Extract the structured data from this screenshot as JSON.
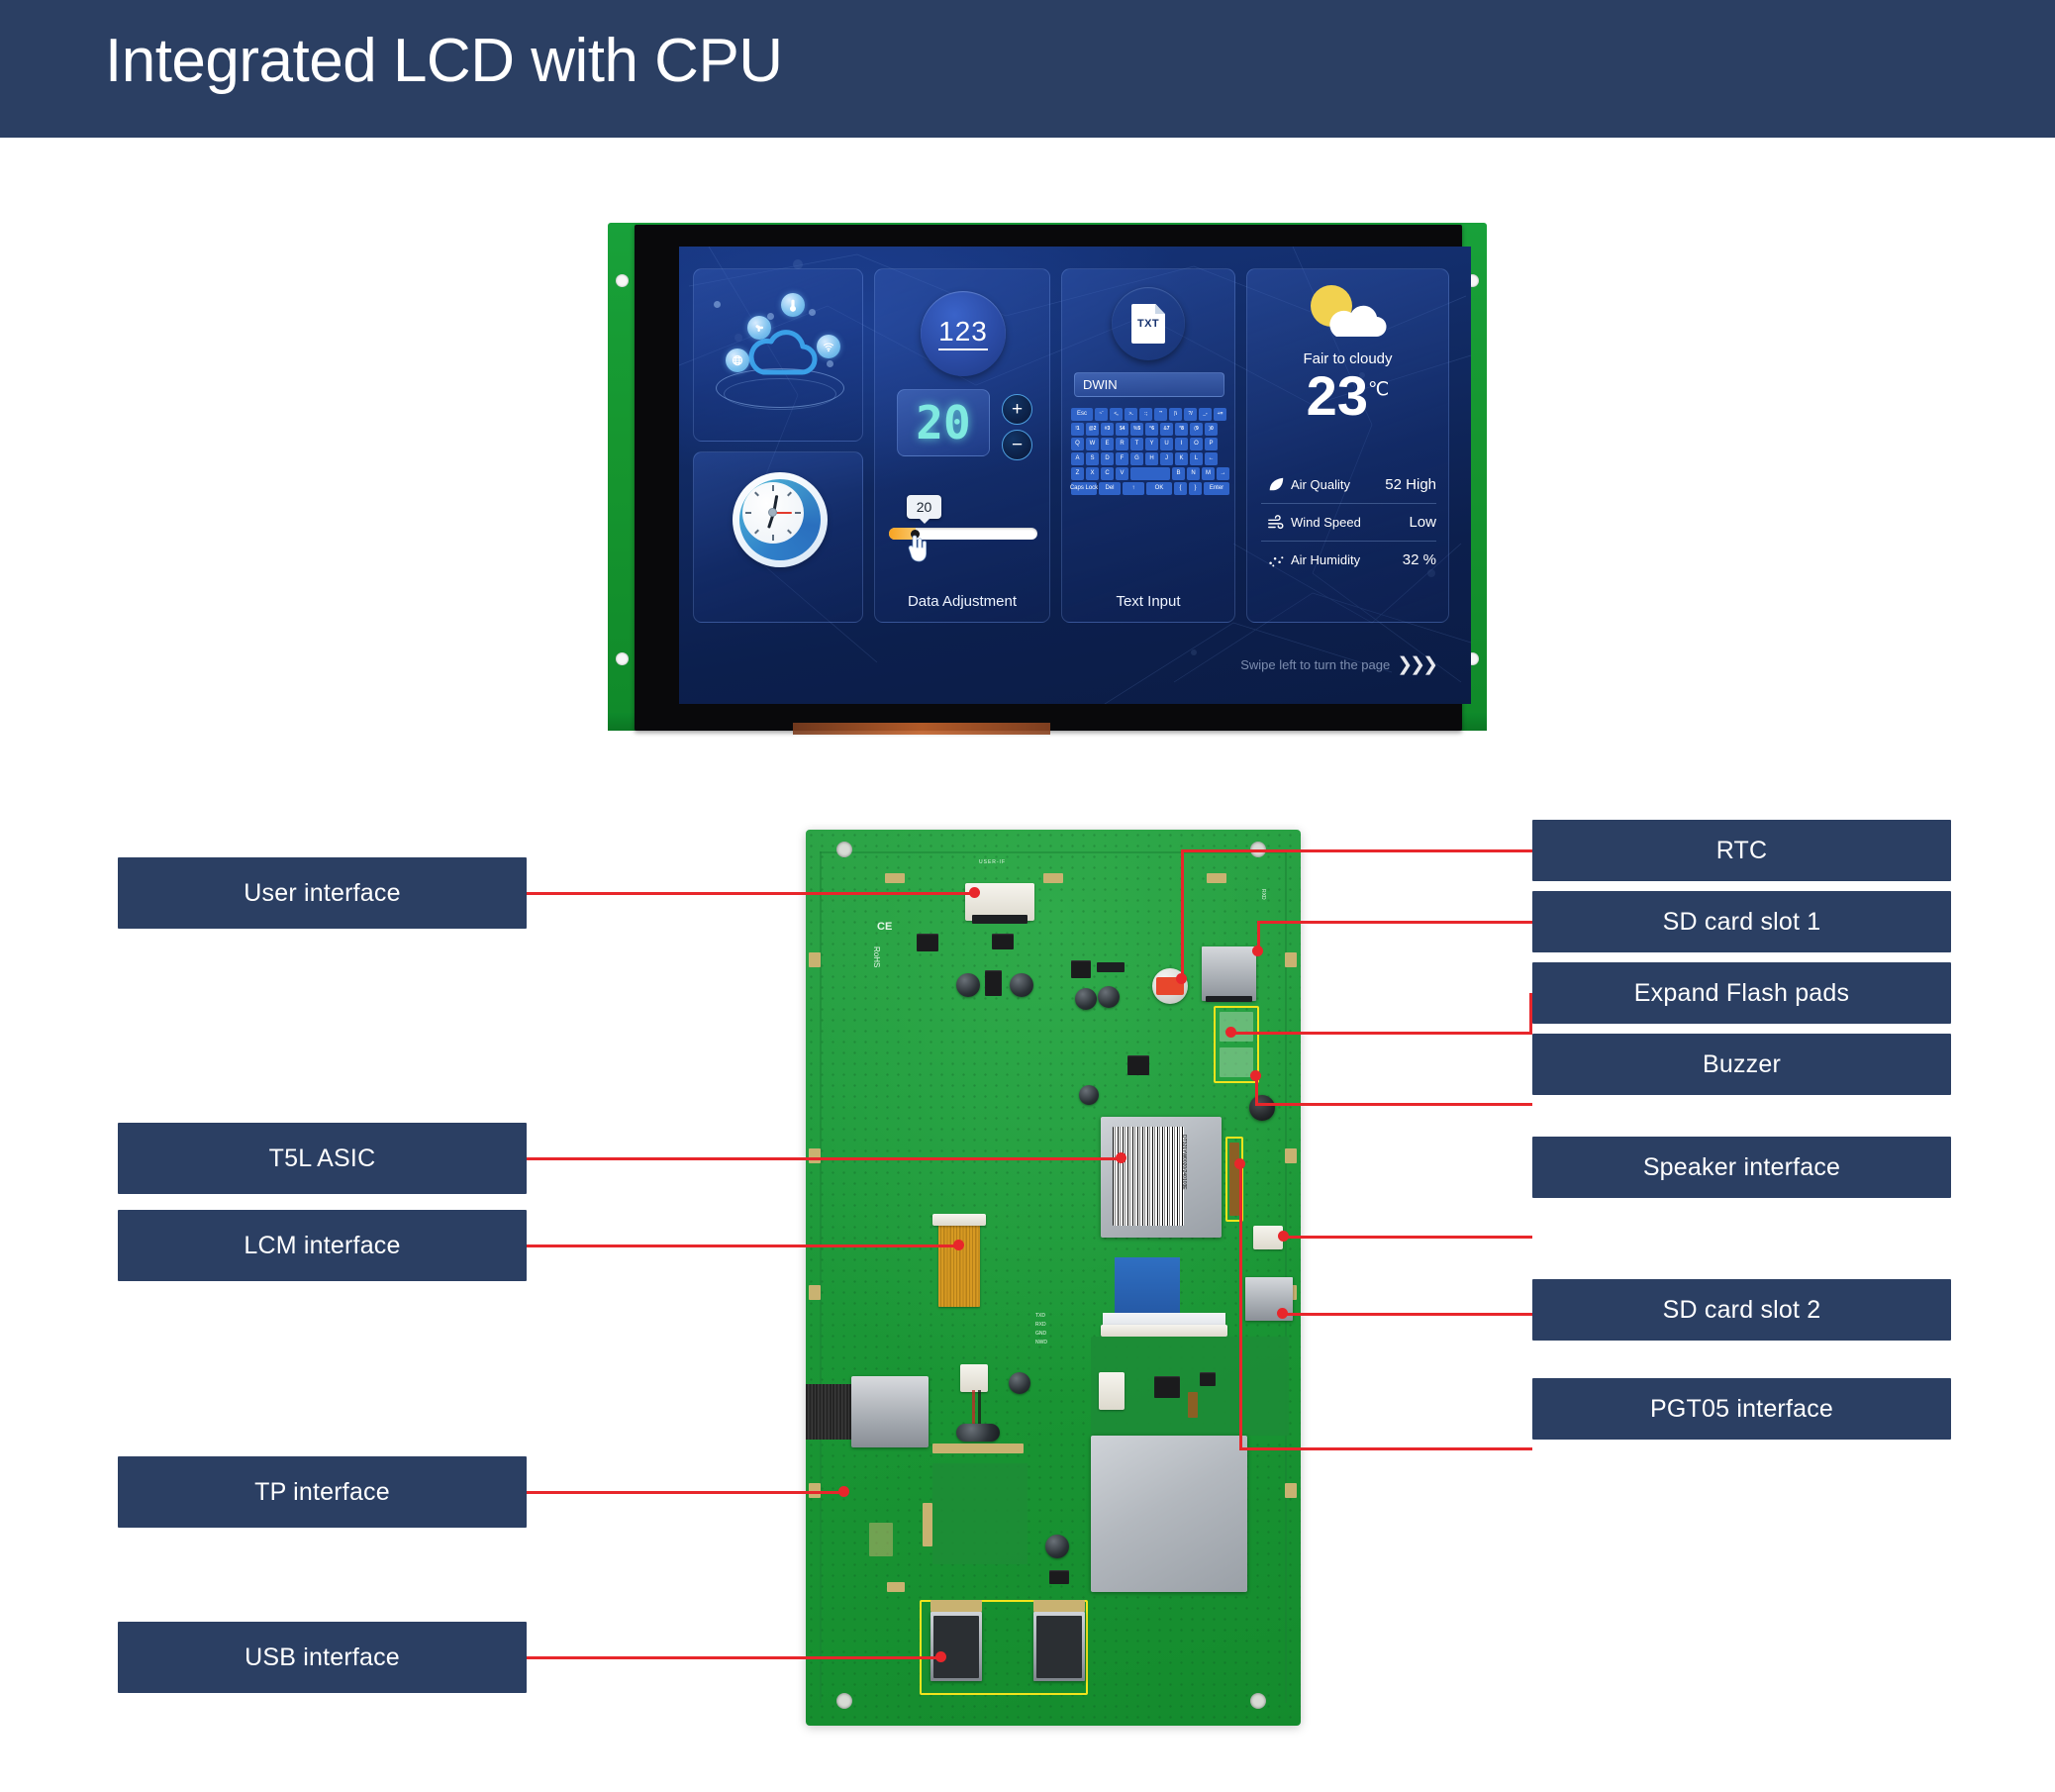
{
  "header": {
    "title": "Integrated LCD with CPU"
  },
  "lcd": {
    "iot_panel": {
      "icons": [
        "thermometer-icon",
        "fan-icon",
        "globe-icon",
        "wifi-icon",
        "cloud-icon"
      ]
    },
    "clock_panel": {
      "name": "analog-clock"
    },
    "data_panel": {
      "badge": "123",
      "value": "20",
      "plus": "+",
      "minus": "−",
      "slider_value": "20",
      "caption": "Data Adjustment"
    },
    "text_panel": {
      "file_label": "TXT",
      "input_value": "DWIN",
      "caption": "Text Input",
      "keyboard": [
        [
          {
            "label": "Esc",
            "w": "wide"
          },
          {
            "top": "~",
            "bottom": "`"
          },
          {
            "top": "<",
            "bottom": ","
          },
          {
            "top": ">",
            "bottom": "."
          },
          {
            "top": ":",
            "bottom": ";"
          },
          {
            "top": "\"",
            "bottom": "'"
          },
          {
            "top": "|",
            "bottom": "\\"
          },
          {
            "top": "?",
            "bottom": "/"
          },
          {
            "top": "_",
            "bottom": "-"
          },
          {
            "top": "+",
            "bottom": "="
          }
        ],
        [
          {
            "top": "!",
            "bottom": "1"
          },
          {
            "top": "@",
            "bottom": "2"
          },
          {
            "top": "#",
            "bottom": "3"
          },
          {
            "top": "$",
            "bottom": "4"
          },
          {
            "top": "%",
            "bottom": "5"
          },
          {
            "top": "^",
            "bottom": "6"
          },
          {
            "top": "&",
            "bottom": "7"
          },
          {
            "top": "*",
            "bottom": "8"
          },
          {
            "top": "(",
            "bottom": "9"
          },
          {
            "top": ")",
            "bottom": "0"
          }
        ],
        [
          {
            "label": "Q"
          },
          {
            "label": "W"
          },
          {
            "label": "E"
          },
          {
            "label": "R"
          },
          {
            "label": "T"
          },
          {
            "label": "Y"
          },
          {
            "label": "U"
          },
          {
            "label": "I"
          },
          {
            "label": "O"
          },
          {
            "label": "P"
          }
        ],
        [
          {
            "label": "A"
          },
          {
            "label": "S"
          },
          {
            "label": "D"
          },
          {
            "label": "F"
          },
          {
            "label": "G"
          },
          {
            "label": "H"
          },
          {
            "label": "J"
          },
          {
            "label": "K"
          },
          {
            "label": "L"
          },
          {
            "label": "←"
          }
        ],
        [
          {
            "label": "Z"
          },
          {
            "label": "X"
          },
          {
            "label": "C"
          },
          {
            "label": "V"
          },
          {
            "label": "",
            "w": "sp"
          },
          {
            "label": "B"
          },
          {
            "label": "N"
          },
          {
            "label": "M"
          },
          {
            "label": "→"
          }
        ],
        [
          {
            "label": "Caps Lock",
            "w": "xwide"
          },
          {
            "label": "Del",
            "w": "wide"
          },
          {
            "label": "↑",
            "w": "wide"
          },
          {
            "label": "OK",
            "w": "xwide"
          },
          {
            "label": "{"
          },
          {
            "label": "}"
          },
          {
            "label": "Enter",
            "w": "xwide"
          }
        ]
      ]
    },
    "weather_panel": {
      "condition": "Fair to cloudy",
      "temperature": "23",
      "unit": "℃",
      "rows": [
        {
          "icon": "leaf-icon",
          "name": "Air Quality",
          "value": "52 High"
        },
        {
          "icon": "wind-icon",
          "name": "Wind Speed",
          "value": "Low"
        },
        {
          "icon": "humidity-icon",
          "name": "Air Humidity",
          "value": "32 %"
        }
      ]
    },
    "swipe_hint": "Swipe left to turn the page",
    "chevrons": "〉〉〉"
  },
  "callouts": {
    "left": [
      {
        "label": "User interface"
      },
      {
        "label": "T5L ASIC"
      },
      {
        "label": "LCM interface"
      },
      {
        "label": "TP interface"
      },
      {
        "label": "USB interface"
      }
    ],
    "right": [
      {
        "label": "RTC"
      },
      {
        "label": "SD card slot 1"
      },
      {
        "label": "Expand Flash pads"
      },
      {
        "label": "Buzzer"
      },
      {
        "label": "Speaker interface"
      },
      {
        "label": "SD card slot 2"
      },
      {
        "label": "PGT05 interface"
      }
    ]
  },
  "board_silk": {
    "rohs": "RoHS",
    "ce": "CE",
    "barcode_text": "DT321YW0020/240103E",
    "pins": [
      "TXD",
      "RXD",
      "GND",
      "NWD"
    ]
  },
  "colors": {
    "header_bg": "#2b3f63",
    "callout_bg": "#2b3f63",
    "leader_red": "#e8262b",
    "pcb_green": "#19943c",
    "highlight_yellow": "#f2e41c",
    "accent_cyan": "#7fe9e0"
  }
}
